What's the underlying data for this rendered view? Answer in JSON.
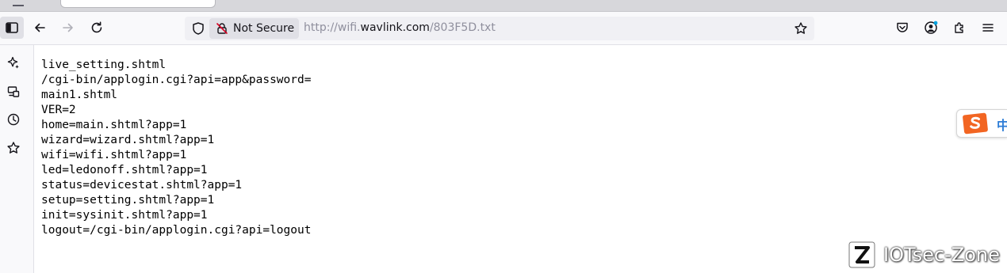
{
  "browser": {
    "security_label": "Not Secure",
    "url_prefix": "http://wifi.",
    "url_host": "wavlink.com",
    "url_path": "/803F5D.txt"
  },
  "document": {
    "lines": [
      "live_setting.shtml",
      "/cgi-bin/applogin.cgi?api=app&password=",
      "main1.shtml",
      "VER=2",
      "home=main.shtml?app=1",
      "wizard=wizard.shtml?app=1",
      "wifi=wifi.shtml?app=1",
      "led=ledonoff.shtml?app=1",
      "status=devicestat.shtml?app=1",
      "setup=setting.shtml?app=1",
      "init=sysinit.shtml?app=1",
      "logout=/cgi-bin/applogin.cgi?api=logout"
    ]
  },
  "ime": {
    "mode_char": "中",
    "icon": "sogou-ime-icon",
    "color": "#f26522"
  },
  "watermark": {
    "text": "IOTsec-Zone"
  },
  "icons": {
    "sidebar_toggle": "sidebar-toggle-icon",
    "back": "back-arrow-icon",
    "forward": "forward-arrow-icon",
    "reload": "reload-icon",
    "tracking": "shield-icon",
    "insecure": "insecure-lock-icon",
    "bookmark": "star-icon",
    "pocket": "pocket-icon",
    "account": "account-icon",
    "extensions": "puzzle-icon",
    "menu": "hamburger-menu-icon",
    "ai_chat": "sparkle-icon",
    "synced_tabs": "synced-tabs-icon",
    "history": "history-icon",
    "bookmarks": "bookmarks-star-icon"
  },
  "colors": {
    "toolbar_bg": "#f9f9fb",
    "urlbar_bg": "#f0f0f4",
    "not_secure_bg": "#e0e0e6",
    "url_dim": "#8f8f9d",
    "account_badge": "#00a3e0"
  }
}
